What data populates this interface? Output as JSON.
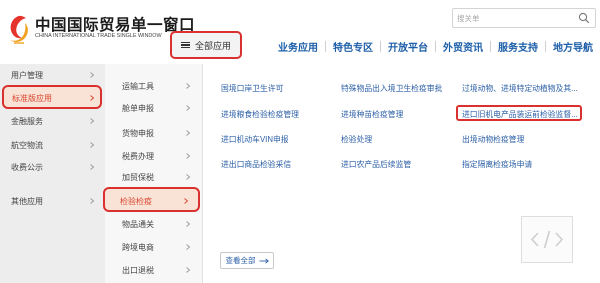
{
  "header": {
    "logo_title": "中国国际贸易单一窗口",
    "logo_subtitle": "CHINA INTERNATIONAL TRADE SINGLE WINDOW",
    "all_apps_label": "全部应用",
    "search_placeholder": "搜关单",
    "nav": [
      "业务应用",
      "特色专区",
      "开放平台",
      "外贸资讯",
      "服务支持",
      "地方导航"
    ]
  },
  "menu": {
    "level1": [
      {
        "label": "用户管理",
        "active": false
      },
      {
        "label": "标准版应用",
        "active": true
      },
      {
        "label": "金融服务",
        "active": false
      },
      {
        "label": "航空物流",
        "active": false
      },
      {
        "label": "收费公示",
        "active": false
      },
      {
        "label": "其他应用",
        "active": false
      }
    ],
    "level2": [
      {
        "label": "运输工具",
        "active": false
      },
      {
        "label": "舱单申报",
        "active": false
      },
      {
        "label": "货物申报",
        "active": false
      },
      {
        "label": "税费办理",
        "active": false
      },
      {
        "label": "加贸保税",
        "active": false
      },
      {
        "label": "检验检疫",
        "active": true
      },
      {
        "label": "物品通关",
        "active": false
      },
      {
        "label": "跨境电商",
        "active": false
      },
      {
        "label": "出口退税",
        "active": false
      }
    ],
    "level3": [
      "国境口岸卫生许可",
      "特殊物品出入境卫生检疫审批",
      "过境动物、进境特定动植物及其...",
      "进境粮食检验检疫管理",
      "进境种苗检疫管理",
      "进口旧机电产品装运前检验监督...",
      "进口机动车VIN申报",
      "检验处理",
      "出境动物检疫管理",
      "进出口商品检验采信",
      "进口农产品后续监管",
      "指定隔离检疫场申请"
    ],
    "view_all_label": "查看全部"
  },
  "colors": {
    "accent_red": "#d9312f",
    "active_bg": "#f9e3d6",
    "link_blue": "#2a5ea6",
    "nav_blue": "#1d5fa9"
  }
}
